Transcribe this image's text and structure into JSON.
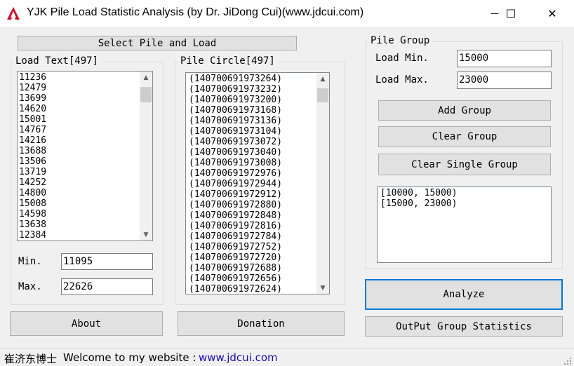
{
  "window": {
    "title": "YJK Pile Load Statistic Analysis (by Dr. JiDong Cui)(www.jdcui.com)",
    "minimize_glyph": "—",
    "maximize_glyph": "☐",
    "close_glyph": "✕"
  },
  "select_button": {
    "label": "Select Pile and Load"
  },
  "load_text": {
    "legend": "Load Text[497]",
    "items": [
      "11236",
      "12479",
      "13699",
      "14620",
      "15001",
      "14767",
      "14216",
      "13688",
      "13506",
      "13719",
      "14252",
      "14800",
      "15008",
      "14598",
      "13638",
      "12384"
    ],
    "min_label": "Min.",
    "min_value": "11095",
    "max_label": "Max.",
    "max_value": "22626"
  },
  "pile_circle": {
    "legend": "Pile Circle[497]",
    "items": [
      "(140700691973264)",
      "(140700691973232)",
      "(140700691973200)",
      "(140700691973168)",
      "(140700691973136)",
      "(140700691973104)",
      "(140700691973072)",
      "(140700691973040)",
      "(140700691973008)",
      "(140700691972976)",
      "(140700691972944)",
      "(140700691972912)",
      "(140700691972880)",
      "(140700691972848)",
      "(140700691972816)",
      "(140700691972784)",
      "(140700691972752)",
      "(140700691972720)",
      "(140700691972688)",
      "(140700691972656)",
      "(140700691972624)"
    ]
  },
  "pile_group": {
    "legend": "Pile Group",
    "load_min_label": "Load Min.",
    "load_min_value": "15000",
    "load_max_label": "Load Max.",
    "load_max_value": "23000",
    "add_group": "Add Group",
    "clear_group": "Clear Group",
    "clear_single_group": "Clear Single Group",
    "groups": [
      "[10000, 15000)",
      "[15000, 23000)"
    ]
  },
  "buttons": {
    "about": "About",
    "donation": "Donation",
    "analyze": "Analyze",
    "output": "OutPut Group Statistics"
  },
  "status": {
    "author": "崔济东博士",
    "welcome": "Welcome to my website :",
    "url": "www.jdcui.com"
  },
  "colors": {
    "accent": "#0078d7",
    "link": "#1a0dab"
  },
  "icons": {
    "app": "autocad-icon",
    "scroll_up": "chevron-up-icon",
    "scroll_down": "chevron-down-icon"
  }
}
